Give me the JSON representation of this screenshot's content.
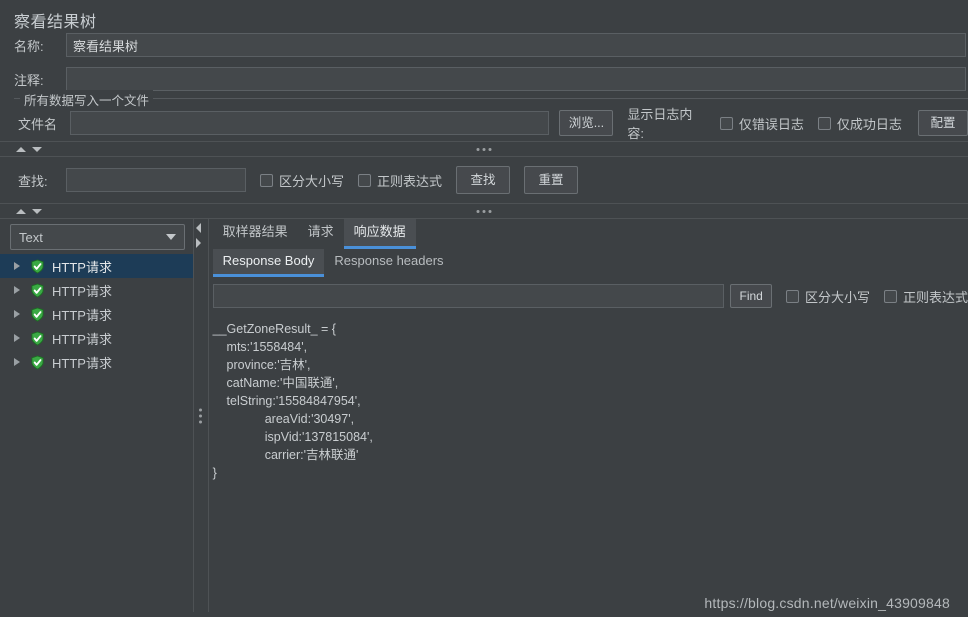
{
  "window": {
    "title": "察看结果树",
    "watermark": "https://blog.csdn.net/weixin_43909848"
  },
  "form": {
    "name_label": "名称:",
    "name_value": "察看结果树",
    "comment_label": "注释:",
    "comment_value": ""
  },
  "file_group": {
    "group_title": "所有数据写入一个文件",
    "filename_label": "文件名",
    "filename_value": "",
    "browse_button": "浏览...",
    "log_display_label": "显示日志内容:",
    "errors_only_checkbox": "仅错误日志",
    "successes_only_checkbox": "仅成功日志",
    "config_button": "配置"
  },
  "search_bar": {
    "find_label": "查找:",
    "find_value": "",
    "case_sensitive_checkbox": "区分大小写",
    "regex_checkbox": "正则表达式",
    "find_button": "查找",
    "reset_button": "重置"
  },
  "left_pane": {
    "renderer_selected": "Text",
    "tree_items": [
      {
        "label": "HTTP请求",
        "selected": true
      },
      {
        "label": "HTTP请求",
        "selected": false
      },
      {
        "label": "HTTP请求",
        "selected": false
      },
      {
        "label": "HTTP请求",
        "selected": false
      },
      {
        "label": "HTTP请求",
        "selected": false
      }
    ]
  },
  "right_pane": {
    "tabs": [
      {
        "label": "取样器结果",
        "active": false
      },
      {
        "label": "请求",
        "active": false
      },
      {
        "label": "响应数据",
        "active": true
      }
    ],
    "subtabs": [
      {
        "label": "Response Body",
        "active": true
      },
      {
        "label": "Response headers",
        "active": false
      }
    ],
    "find": {
      "value": "",
      "button": "Find",
      "case_sensitive_checkbox": "区分大小写",
      "regex_checkbox": "正则表达式"
    },
    "response_body": "__GetZoneResult_ = {\n    mts:'1558484',\n    province:'吉林',\n    catName:'中国联通',\n    telString:'15584847954',\n               areaVid:'30497',\n               ispVid:'137815084',\n               carrier:'吉林联通'\n}"
  },
  "colors": {
    "background": "#3c4043",
    "field": "#44484b",
    "accent_blue": "#4a90d9",
    "selection": "#1d3c57",
    "text": "#c3c7ca",
    "shield_green": "#35a03a"
  }
}
